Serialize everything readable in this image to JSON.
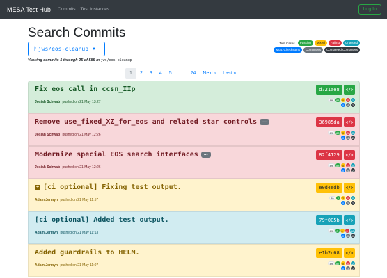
{
  "navbar": {
    "brand": "MESA Test Hub",
    "links": [
      "Commits",
      "Test Instances"
    ],
    "login_label": "Log In"
  },
  "page": {
    "title": "Search Commits",
    "branch": "jws/eos-cleanup",
    "branch_icon": "git-branch-icon",
    "viewing_prefix": "Viewing commits 1 through 25 of 585 in ",
    "viewing_branch": "jws/eos-cleanup"
  },
  "legend": {
    "test_cases_label": "Test Cases",
    "test_case_pills": [
      "Passing",
      "Mixed",
      "Failing",
      "Untested"
    ],
    "computer_pills": [
      "Mult. Checksums",
      "Computers",
      "Completed Computers"
    ]
  },
  "pagination": {
    "pages": [
      "1",
      "2",
      "3",
      "4",
      "5",
      "…",
      "24"
    ],
    "next_label": "Next ›",
    "last_label": "Last »",
    "active_page": "1"
  },
  "commits": [
    {
      "status": "green",
      "message": "Fix eos call in ccsn_IIp",
      "has_more": false,
      "expandable": false,
      "author": "Josiah Schwab",
      "pushed": "pushed on 21 May 13:27",
      "sha": "d721ae8",
      "code_label": "</>",
      "stats_row1": [
        "89",
        "88",
        "0",
        "0",
        "1"
      ],
      "stats_row2": [
        "0",
        "4",
        "2"
      ]
    },
    {
      "status": "red",
      "message": "Remove use_fixed_XZ_for_eos and related star controls",
      "has_more": true,
      "more_label": "...",
      "expandable": false,
      "author": "Josiah Schwab",
      "pushed": "pushed on 21 May 12:26",
      "sha": "36985da",
      "code_label": "</>",
      "stats_row1": [
        "89",
        "88",
        "0",
        "1",
        "0"
      ],
      "stats_row2": [
        "0",
        "4",
        "2"
      ]
    },
    {
      "status": "red",
      "message": "Modernize special EOS search interfaces",
      "has_more": true,
      "more_label": "...",
      "expandable": false,
      "author": "Josiah Schwab",
      "pushed": "pushed on 21 May 12:26",
      "sha": "82f4129",
      "code_label": "</>",
      "stats_row1": [
        "89",
        "88",
        "0",
        "1",
        "0"
      ],
      "stats_row2": [
        "0",
        "4",
        "2"
      ]
    },
    {
      "status": "yellow",
      "message": "[ci optional] Fixing test output.",
      "has_more": false,
      "expandable": true,
      "expand_label": "+",
      "author": "Adam Jermyn",
      "pushed": "pushed on 21 May 11:57",
      "sha": "e0d4edb",
      "code_label": "</>",
      "stats_row1": [
        "89",
        "0",
        "2",
        "0",
        "0"
      ],
      "stats_row2": [
        "0",
        "3",
        "2"
      ]
    },
    {
      "status": "blue",
      "message": "[ci optional] Added test output.",
      "has_more": false,
      "expandable": false,
      "author": "Adam Jermyn",
      "pushed": "pushed on 21 May 11:13",
      "sha": "79f005b",
      "code_label": "</>",
      "stats_row1": [
        "89",
        "0",
        "0",
        "0",
        "88"
      ],
      "stats_row2": [
        "0",
        "0",
        "0"
      ]
    },
    {
      "status": "yellow",
      "message": "Added guardrails to HELM.",
      "has_more": false,
      "expandable": false,
      "author": "Adam Jermyn",
      "pushed": "pushed on 21 May 11:07",
      "sha": "e1b2c68",
      "code_label": "</>",
      "stats_row1": [
        "89",
        "87",
        "0",
        "0",
        "2"
      ],
      "stats_row2": [
        "0",
        "3",
        "2"
      ]
    }
  ],
  "colors": {
    "passing": "#28a745",
    "mixed": "#ffc107",
    "failing": "#dc3545",
    "untested": "#17a2b8",
    "mult_checksums": "#007bff",
    "computers": "#6c757d",
    "completed_computers": "#343a40"
  }
}
